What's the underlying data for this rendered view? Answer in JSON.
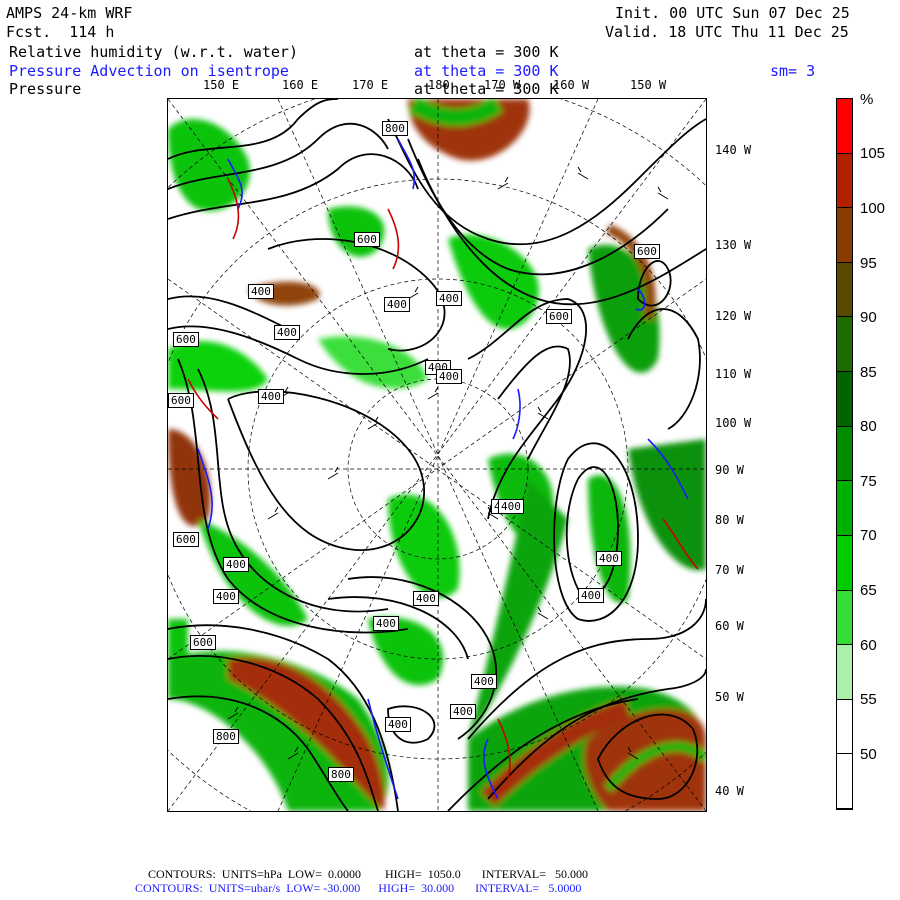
{
  "header": {
    "model": "AMPS 24-km WRF",
    "forecast": "Fcst.  114 h",
    "init": "Init. 00 UTC Sun 07 Dec 25",
    "valid": "Valid. 18 UTC Thu 11 Dec 25",
    "field1_name": "Relative humidity (w.r.t. water)",
    "field1_level": "at theta = 300 K",
    "field2_name": "Pressure Advection on isentrope",
    "field2_level": "at theta = 300 K",
    "smoothing": "sm= 3",
    "field3_name": "Pressure",
    "field3_level": "at theta = 300 K"
  },
  "top_longitudes": [
    "150 E",
    "160 E",
    "170 E",
    "180",
    "170 W",
    "160 W",
    "150 W"
  ],
  "right_longitudes": [
    "140 W",
    "130 W",
    "120 W",
    "110 W",
    "100 W",
    "90 W",
    "80 W",
    "70 W",
    "60 W",
    "50 W",
    "40 W"
  ],
  "contour_labels": [
    "800",
    "600",
    "600",
    "400",
    "400",
    "400",
    "400",
    "600",
    "600",
    "400",
    "400",
    "600",
    "400",
    "400",
    "600",
    "400",
    "400",
    "400",
    "400",
    "400",
    "400",
    "400",
    "400",
    "400",
    "400",
    "800",
    "600",
    "800"
  ],
  "colorbar": {
    "unit": "%",
    "labels": [
      "105",
      "100",
      "95",
      "90",
      "85",
      "80",
      "75",
      "70",
      "65",
      "60",
      "55",
      "50"
    ],
    "colors": [
      "#ff0000",
      "#b22000",
      "#8b3a00",
      "#5a4a00",
      "#1e6b00",
      "#006400",
      "#008c00",
      "#00b000",
      "#00cc00",
      "#33dd33",
      "#aaf0aa",
      "#ffffff",
      "#ffffff"
    ]
  },
  "footer": {
    "line1": "CONTOURS:  UNITS=hPa  LOW=  0.0000        HIGH=  1050.0       INTERVAL=   50.000",
    "line2": "CONTOURS:  UNITS=ubar/s  LOW= -30.000      HIGH=  30.000       INTERVAL=   5.0000"
  }
}
